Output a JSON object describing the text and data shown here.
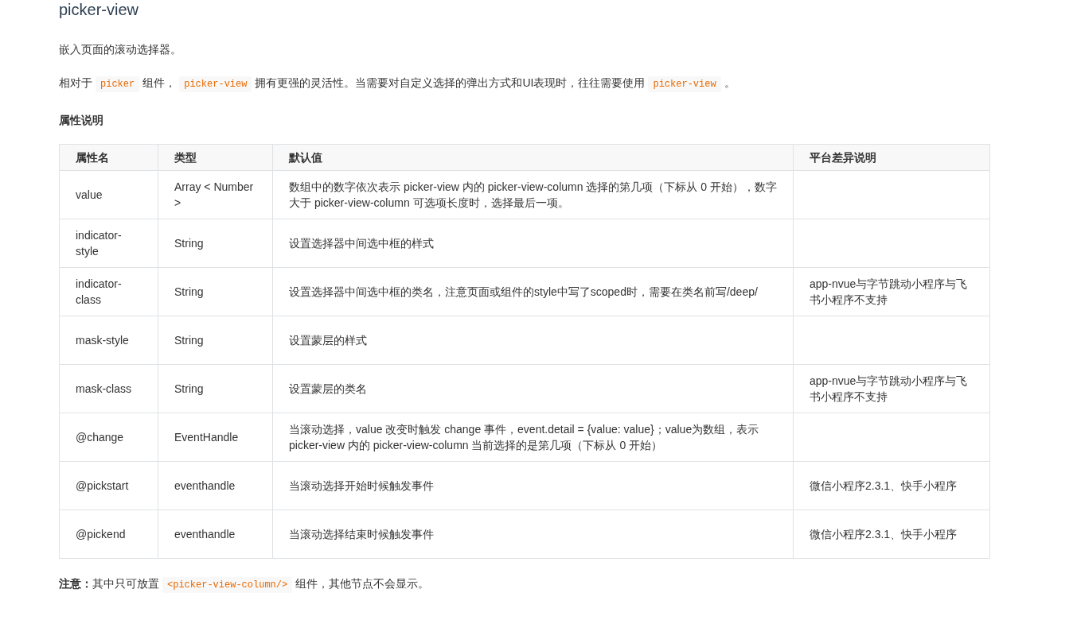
{
  "title": "picker-view",
  "paragraphs": [
    [
      {
        "kind": "text",
        "text": "嵌入页面的滚动选择器。"
      }
    ],
    [
      {
        "kind": "text",
        "text": "相对于"
      },
      {
        "kind": "code",
        "text": "picker"
      },
      {
        "kind": "text",
        "text": "组件，"
      },
      {
        "kind": "code",
        "text": "picker-view"
      },
      {
        "kind": "text",
        "text": "拥有更强的灵活性。当需要对自定义选择的弹出方式和UI表现时，往往需要使用"
      },
      {
        "kind": "code",
        "text": "picker-view"
      },
      {
        "kind": "text",
        "text": "。"
      }
    ]
  ],
  "section_heading": "属性说明",
  "table": {
    "columns": [
      "属性名",
      "类型",
      "默认值",
      "平台差异说明"
    ],
    "rows": [
      [
        "value",
        "Array < Number >",
        "数组中的数字依次表示 picker-view 内的 picker-view-column 选择的第几项（下标从 0 开始），数字大于 picker-view-column 可选项长度时，选择最后一项。",
        ""
      ],
      [
        "indicator-style",
        "String",
        "设置选择器中间选中框的样式",
        ""
      ],
      [
        "indicator-class",
        "String",
        "设置选择器中间选中框的类名，注意页面或组件的style中写了scoped时，需要在类名前写/deep/",
        "app-nvue与字节跳动小程序与飞书小程序不支持"
      ],
      [
        "mask-style",
        "String",
        "设置蒙层的样式",
        ""
      ],
      [
        "mask-class",
        "String",
        "设置蒙层的类名",
        "app-nvue与字节跳动小程序与飞书小程序不支持"
      ],
      [
        "@change",
        "EventHandle",
        "当滚动选择，value 改变时触发 change 事件，event.detail = {value: value}；value为数组，表示 picker-view 内的 picker-view-column 当前选择的是第几项（下标从 0 开始）",
        ""
      ],
      [
        "@pickstart",
        "eventhandle",
        "当滚动选择开始时候触发事件",
        "微信小程序2.3.1、快手小程序"
      ],
      [
        "@pickend",
        "eventhandle",
        "当滚动选择结束时候触发事件",
        "微信小程序2.3.1、快手小程序"
      ]
    ]
  },
  "note": [
    {
      "kind": "bold",
      "text": "注意："
    },
    {
      "kind": "text",
      "text": "其中只可放置"
    },
    {
      "kind": "code",
      "text": "<picker-view-column/>"
    },
    {
      "kind": "text",
      "text": "组件，其他节点不会显示。"
    }
  ]
}
